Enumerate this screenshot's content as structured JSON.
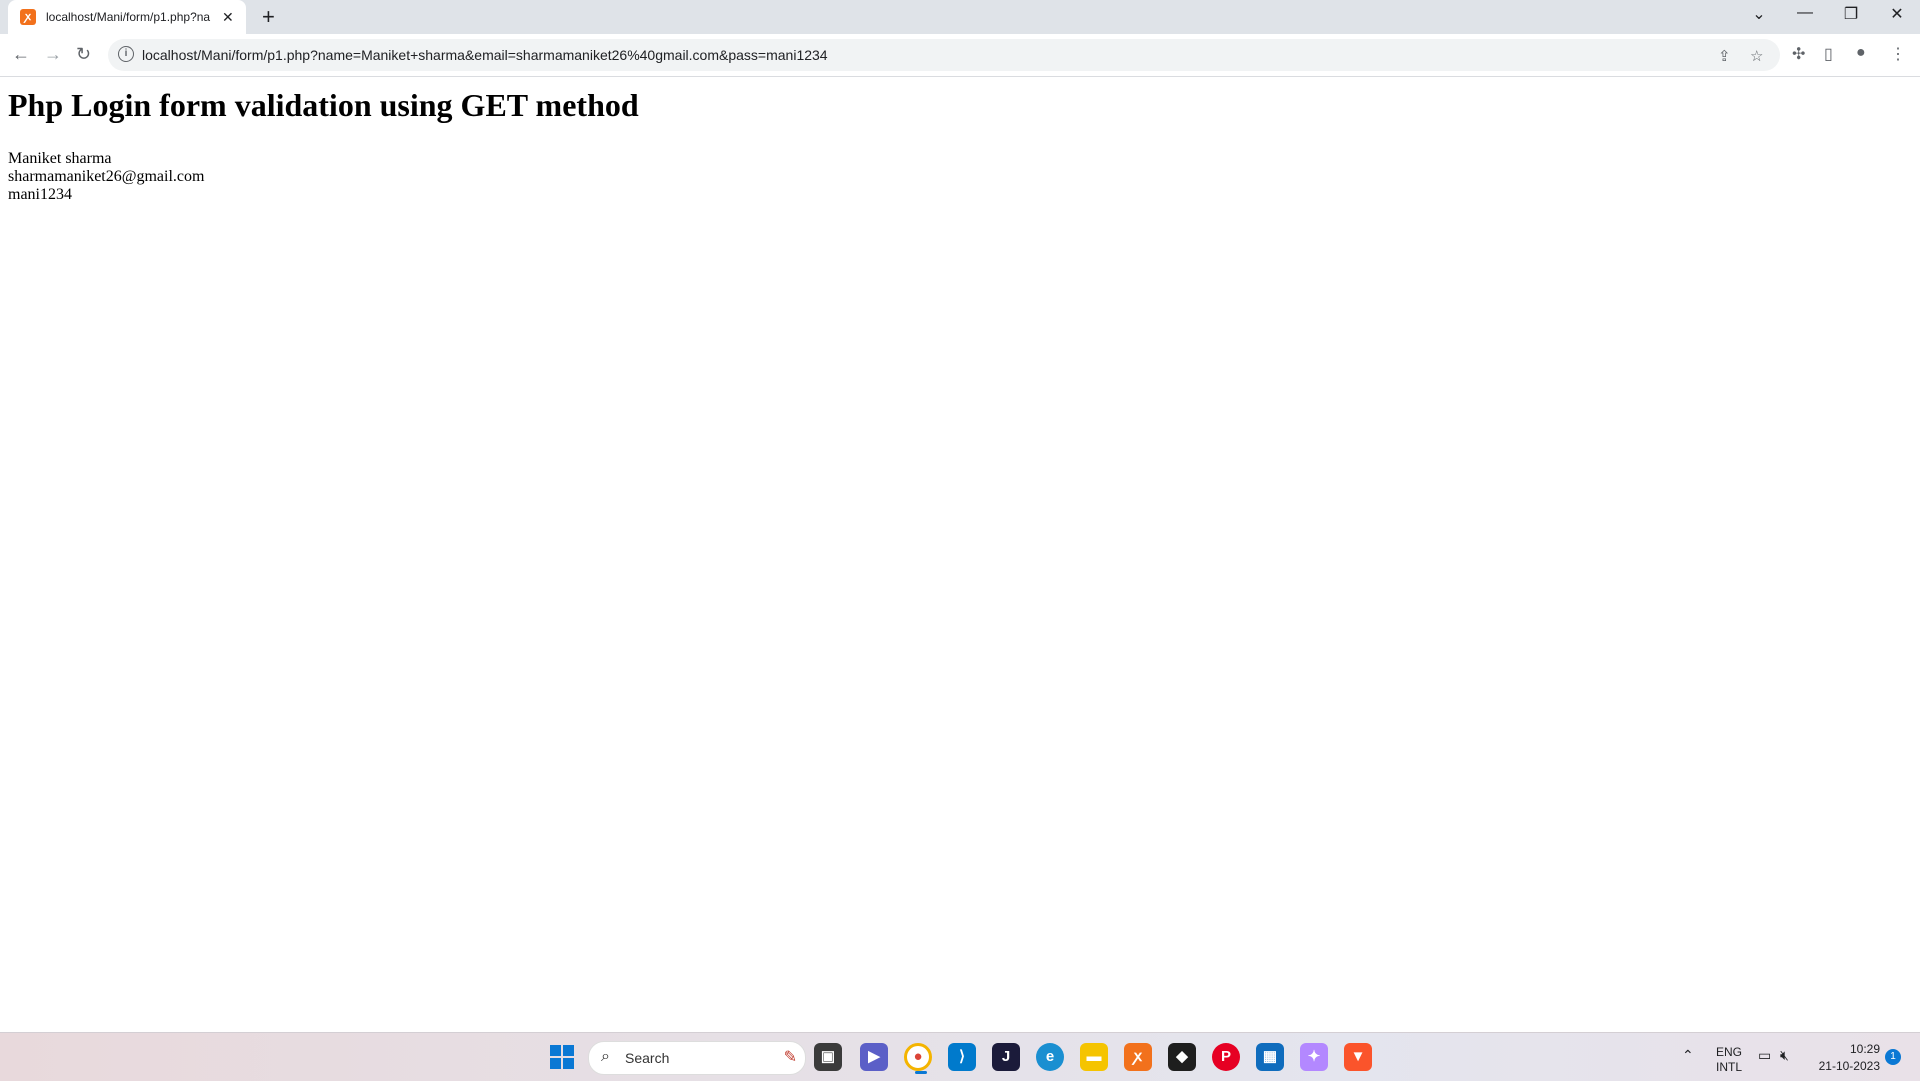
{
  "browser": {
    "tab_title": "localhost/Mani/form/p1.php?na",
    "tab_close": "✕",
    "new_tab": "+",
    "address": "localhost/Mani/form/p1.php?name=Maniket+sharma&email=sharmamaniket26%40gmail.com&pass=mani1234"
  },
  "page": {
    "heading": "Php Login form validation using GET method",
    "name": "Maniket sharma",
    "email": "sharmamaniket26@gmail.com",
    "pass": "mani1234"
  },
  "taskbar": {
    "search_placeholder": "Search",
    "lang_top": "ENG",
    "lang_bottom": "INTL",
    "time": "10:29",
    "date": "21-10-2023",
    "notification_count": "1"
  }
}
